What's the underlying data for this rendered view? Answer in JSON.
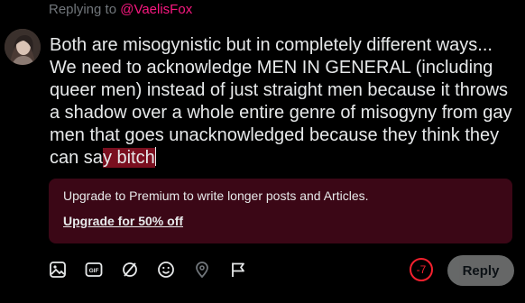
{
  "reply_context": {
    "prefix": "Replying to ",
    "handle": "@VaelisFox"
  },
  "compose": {
    "text_within_limit": "Both are misogynistic but in completely different ways... We need to acknowledge MEN IN GENERAL (including queer men) instead of just straight men because it throws a shadow over a whole entire genre of misogyny from gay men that goes unacknowledged because they think they can sa",
    "text_over_limit": "y bitch"
  },
  "upsell": {
    "message": "Upgrade to Premium to write longer posts and Articles.",
    "link_label": "Upgrade for 50% off"
  },
  "toolbar": {
    "icons": [
      "media-icon",
      "gif-icon",
      "grok-icon",
      "emoji-icon",
      "location-icon",
      "flag-icon"
    ]
  },
  "char_counter": "-7",
  "reply_button_label": "Reply",
  "colors": {
    "background": "#000000",
    "text": "#e7e9ea",
    "muted": "#71767b",
    "handle": "#f91880",
    "over_limit_highlight": "#7a0f1f",
    "upsell_bg": "#3b0716",
    "counter": "#f4212e",
    "reply_button_bg": "#787a7a"
  }
}
